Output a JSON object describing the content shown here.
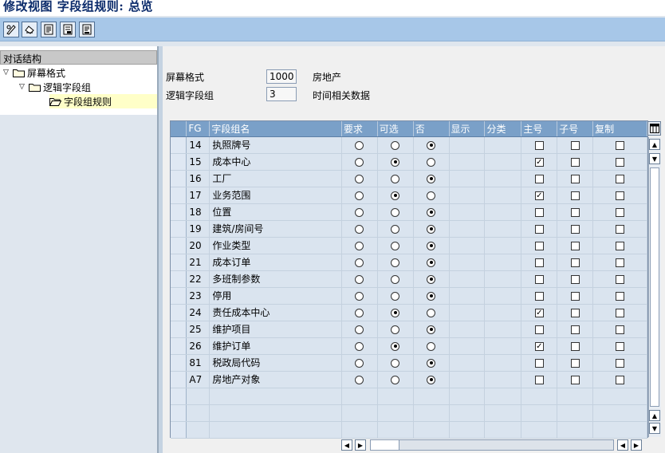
{
  "window": {
    "title": "修改视图 字段组规则: 总览"
  },
  "toolbar": {
    "buttons": [
      {
        "icon": "pencil-glasses-icon"
      },
      {
        "icon": "undo-icon"
      },
      {
        "icon": "list-icon"
      },
      {
        "icon": "export-icon"
      },
      {
        "icon": "document-icon"
      }
    ]
  },
  "dialog_structure": {
    "header": "对话结构",
    "items": [
      {
        "label": "屏幕格式",
        "icon": "folder-icon",
        "expanded": true
      },
      {
        "label": "逻辑字段组",
        "icon": "folder-icon",
        "expanded": true
      },
      {
        "label": "字段组规则",
        "icon": "folder-open-icon",
        "selected": true
      }
    ]
  },
  "form": {
    "screen_format_label": "屏幕格式",
    "screen_format_value": "1000",
    "screen_format_desc": "房地产",
    "field_group_label": "逻辑字段组",
    "field_group_value": "3",
    "field_group_desc": "时间相关数据"
  },
  "table": {
    "columns": [
      "FG",
      "字段组名",
      "要求",
      "可选",
      "否",
      "显示",
      "分类",
      "主号",
      "子号",
      "复制"
    ],
    "rows": [
      {
        "fg": "14",
        "name": "执照牌号",
        "option": "否",
        "main": false,
        "sub": false,
        "copy": false
      },
      {
        "fg": "15",
        "name": "成本中心",
        "option": "可选",
        "main": true,
        "sub": false,
        "copy": false
      },
      {
        "fg": "16",
        "name": "工厂",
        "option": "否",
        "main": false,
        "sub": false,
        "copy": false
      },
      {
        "fg": "17",
        "name": "业务范围",
        "option": "可选",
        "main": true,
        "sub": false,
        "copy": false
      },
      {
        "fg": "18",
        "name": "位置",
        "option": "否",
        "main": false,
        "sub": false,
        "copy": false
      },
      {
        "fg": "19",
        "name": "建筑/房间号",
        "option": "否",
        "main": false,
        "sub": false,
        "copy": false
      },
      {
        "fg": "20",
        "name": "作业类型",
        "option": "否",
        "main": false,
        "sub": false,
        "copy": false
      },
      {
        "fg": "21",
        "name": "成本订单",
        "option": "否",
        "main": false,
        "sub": false,
        "copy": false
      },
      {
        "fg": "22",
        "name": "多班制参数",
        "option": "否",
        "main": false,
        "sub": false,
        "copy": false
      },
      {
        "fg": "23",
        "name": "停用",
        "option": "否",
        "main": false,
        "sub": false,
        "copy": false
      },
      {
        "fg": "24",
        "name": "责任成本中心",
        "option": "可选",
        "main": true,
        "sub": false,
        "copy": false
      },
      {
        "fg": "25",
        "name": "维护项目",
        "option": "否",
        "main": false,
        "sub": false,
        "copy": false
      },
      {
        "fg": "26",
        "name": "维护订单",
        "option": "可选",
        "main": true,
        "sub": false,
        "copy": false
      },
      {
        "fg": "81",
        "name": "税政局代码",
        "option": "否",
        "main": false,
        "sub": false,
        "copy": false
      },
      {
        "fg": "A7",
        "name": "房地产对象",
        "option": "否",
        "main": false,
        "sub": false,
        "copy": false
      }
    ],
    "empty_rows": 3
  }
}
